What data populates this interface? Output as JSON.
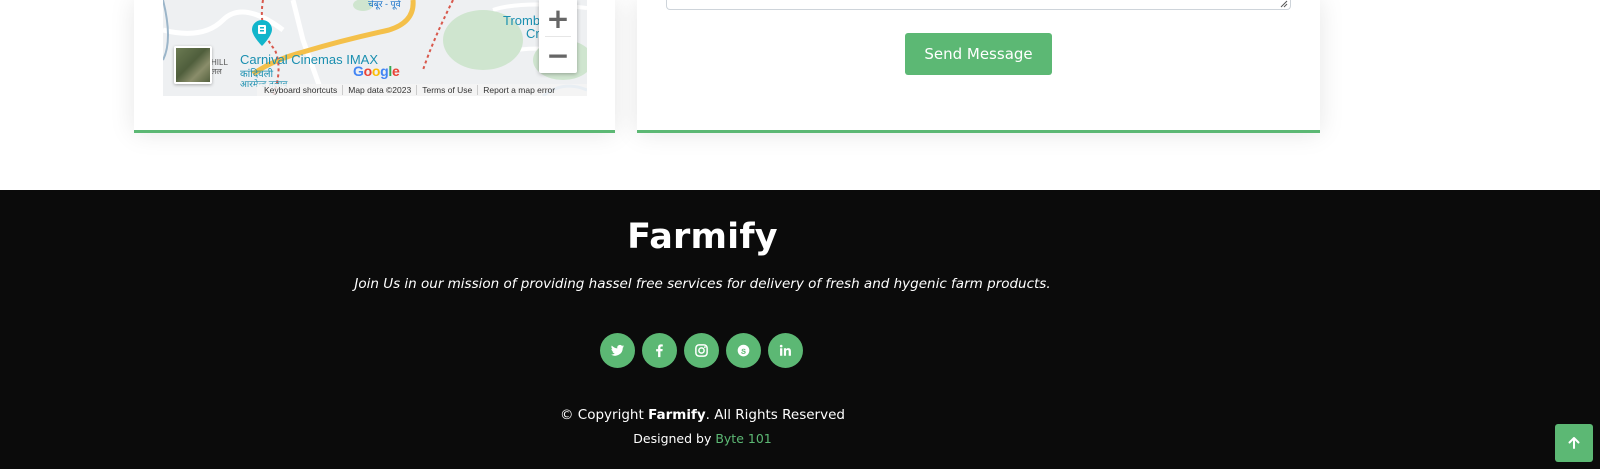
{
  "map": {
    "poi_label": "Carnival Cinemas IMAX",
    "local_label_1": "कांदिवली",
    "local_label_2": "आरमेन्ड तलाव",
    "area_label_1": "Tromb",
    "area_label_2": "Cr",
    "hill_label": "HILL\nलल",
    "top_label": "चेंबूर - पूर्व",
    "google_letters": [
      "G",
      "o",
      "o",
      "g",
      "l",
      "e"
    ],
    "zoom_in": "+",
    "zoom_out": "−",
    "footer_links": [
      "Keyboard shortcuts",
      "Map data ©2023",
      "Terms of Use",
      "Report a map error"
    ]
  },
  "form": {
    "send_label": "Send Message"
  },
  "footer": {
    "title": "Farmify",
    "tagline": "Join Us in our mission of providing hassel free services for delivery of fresh and hygenic farm products.",
    "social": [
      "twitter-icon",
      "facebook-icon",
      "instagram-icon",
      "skype-icon",
      "linkedin-icon"
    ],
    "copyright_prefix": "© Copyright ",
    "copyright_brand": "Farmify",
    "copyright_suffix": ". All Rights Reserved",
    "designed_prefix": "Designed by ",
    "designed_link": "Byte 101"
  },
  "colors": {
    "accent": "#5cb874",
    "footer_bg": "#0b0b0b"
  }
}
